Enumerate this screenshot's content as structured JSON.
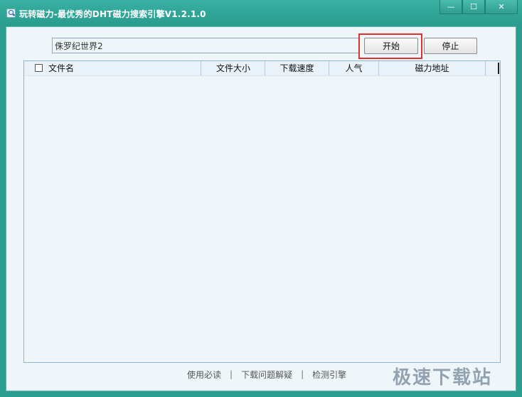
{
  "window": {
    "title": "玩转磁力-最优秀的DHT磁力搜索引擎V1.2.1.0"
  },
  "search": {
    "value": "侏罗纪世界2"
  },
  "buttons": {
    "start": "开始",
    "stop": "停止"
  },
  "list": {
    "columns": [
      "文件名",
      "文件大小",
      "下载速度",
      "人气",
      "磁力地址"
    ],
    "rows": []
  },
  "footer": {
    "links": [
      "使用必读",
      "下载问题解疑",
      "检测引擎"
    ],
    "separator": "|"
  },
  "watermark": "极速下载站",
  "colors": {
    "titlebar": "#2c9e90",
    "client_bg": "#eef6fa",
    "highlight": "#e03030"
  }
}
